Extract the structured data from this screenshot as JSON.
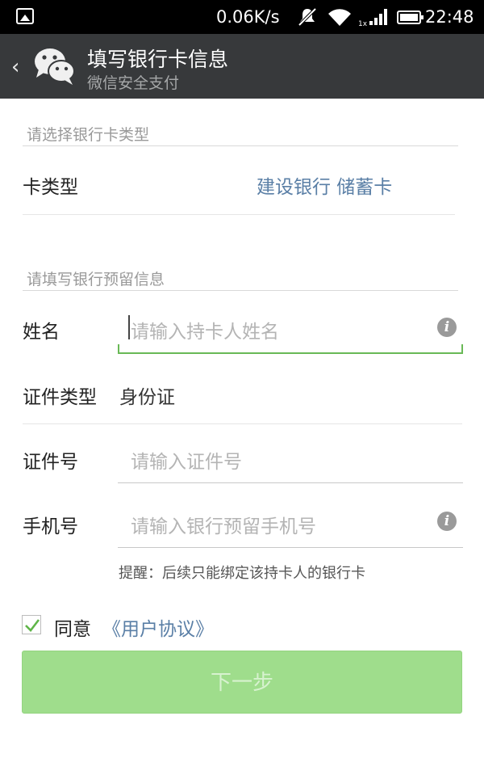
{
  "status_bar": {
    "network_speed": "0.06K/s",
    "time": "22:48",
    "icons": [
      "image-icon",
      "mute-icon",
      "wifi-icon",
      "signal-icon",
      "battery-icon"
    ]
  },
  "app_bar": {
    "title": "填写银行卡信息",
    "subtitle": "微信安全支付",
    "back_icon": "chevron-left-icon",
    "logo_icon": "wechat-icon"
  },
  "card_section": {
    "header": "请选择银行卡类型",
    "card_type_label": "卡类型",
    "card_type_value": "建设银行 储蓄卡"
  },
  "info_section": {
    "header": "请填写银行预留信息",
    "name_label": "姓名",
    "name_placeholder": "请输入持卡人姓名",
    "id_type_label": "证件类型",
    "id_type_value": "身份证",
    "id_number_label": "证件号",
    "id_number_placeholder": "请输入证件号",
    "phone_label": "手机号",
    "phone_placeholder": "请输入银行预留手机号"
  },
  "reminder": "提醒：后续只能绑定该持卡人的银行卡",
  "agreement": {
    "checked": true,
    "agree_label": "同意",
    "link_label": "《用户协议》"
  },
  "next_button": "下一步",
  "colors": {
    "app_bar_bg": "#37393b",
    "accent_green": "#69b956",
    "button_disabled_bg": "#9fdd8c",
    "link_blue": "#5a7fa6"
  }
}
